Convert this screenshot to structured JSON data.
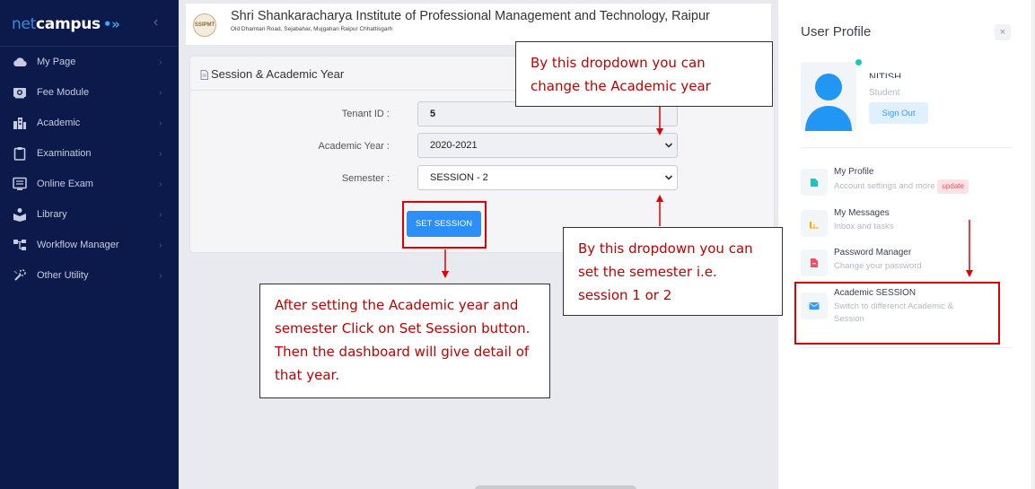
{
  "sidebar": {
    "brand_part1": "net",
    "brand_part2": "campus",
    "brand_mark": "•»",
    "collapse_icon": "chevrons-left-icon",
    "items": [
      {
        "label": "My Page",
        "icon": "cloud-icon"
      },
      {
        "label": "Fee Module",
        "icon": "camera-icon"
      },
      {
        "label": "Academic",
        "icon": "building-icon"
      },
      {
        "label": "Examination",
        "icon": "clipboard-icon"
      },
      {
        "label": "Online Exam",
        "icon": "monitor-icon"
      },
      {
        "label": "Library",
        "icon": "reader-icon"
      },
      {
        "label": "Workflow Manager",
        "icon": "workflow-icon"
      },
      {
        "label": "Other Utility",
        "icon": "tools-icon"
      }
    ]
  },
  "header": {
    "logo_text": "SSIPMT",
    "institute_name": "Shri Shankaracharya Institute of Professional Management and Technology, Raipur",
    "institute_address": "Old Dhamtari Road, Sejabahar, Mujgahan Raipur Chhattisgarh"
  },
  "session_card": {
    "title": "Session & Academic Year",
    "tenant_label": "Tenant ID :",
    "tenant_value": "5",
    "year_label": "Academic Year :",
    "year_value": "2020-2021",
    "semester_label": "Semester :",
    "semester_value": "SESSION - 2",
    "button_label": "SET SESSION"
  },
  "panel": {
    "title": "User Profile",
    "close": "×",
    "user_name": "NITISH",
    "user_role": "Student",
    "signout_label": "Sign Out",
    "items": [
      {
        "title": "My Profile",
        "subtitle": "Account settings and more",
        "badge": "update",
        "icon": "profile-icon",
        "color": "#1bc5bd"
      },
      {
        "title": "My Messages",
        "subtitle": "Inbox and tasks",
        "icon": "chart-icon",
        "color": "#ffa800"
      },
      {
        "title": "Password Manager",
        "subtitle": "Change your password",
        "icon": "password-icon",
        "color": "#f64e60"
      },
      {
        "title": "Academic SESSION",
        "subtitle": "Switch to differenct Academic & Session",
        "icon": "mail-icon",
        "color": "#3699ff"
      }
    ]
  },
  "annotations": {
    "year_callout": "By this dropdown you can change the Academic year",
    "semester_callout": "By this dropdown you can set the semester i.e. session 1 or 2",
    "button_callout": "After setting the Academic year and semester Click on Set Session button. Then the dashboard will give detail of that year."
  },
  "colors": {
    "sidebar_bg": "#0b1a4a",
    "primary": "#2c8ef7",
    "annotation_red": "#c00000"
  }
}
